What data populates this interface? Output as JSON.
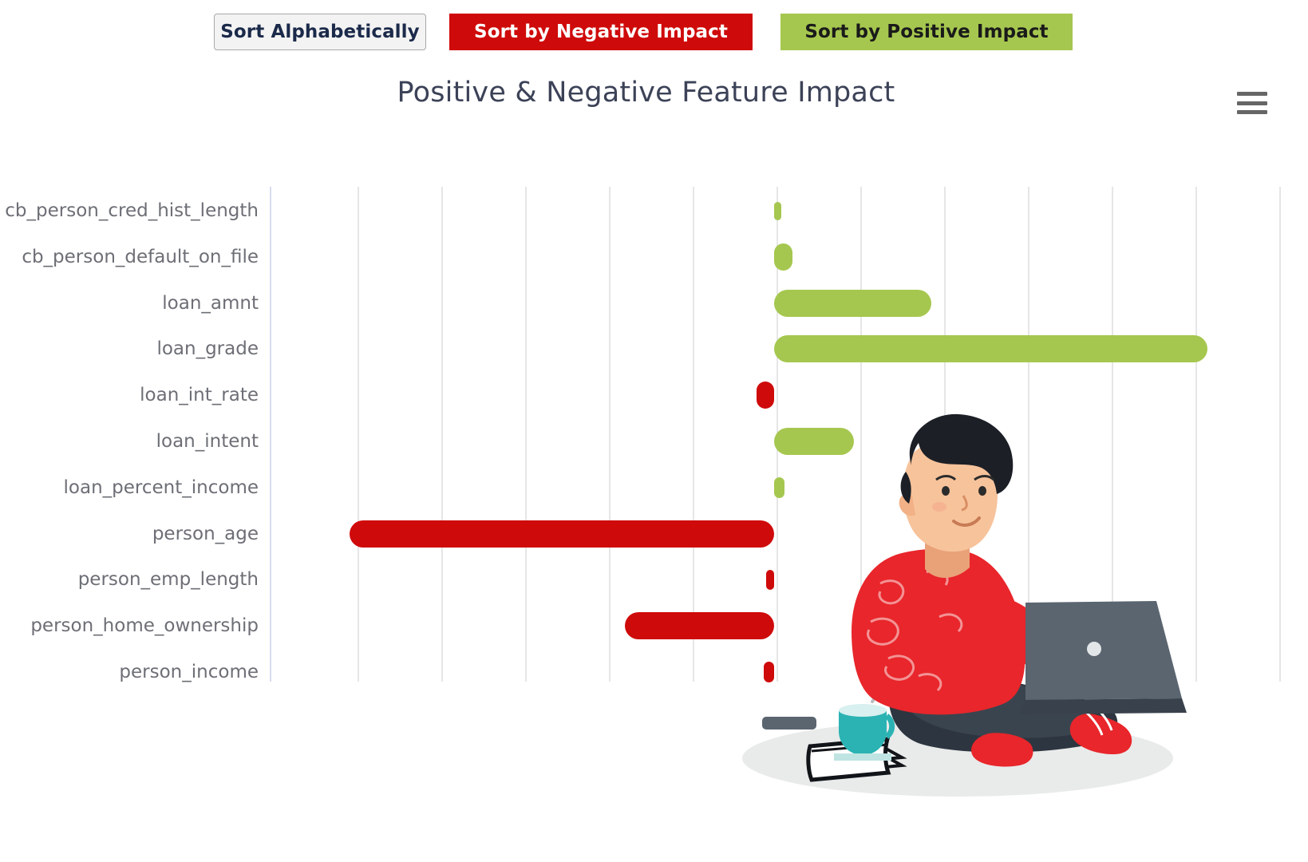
{
  "toolbar": {
    "sort_alphabetically": "Sort Alphabetically",
    "sort_by_negative": "Sort by Negative Impact",
    "sort_by_positive": "Sort by Positive Impact"
  },
  "menu": {
    "icon": "hamburger-menu-icon"
  },
  "chart_data": {
    "type": "bar",
    "orientation": "horizontal",
    "title": "Positive & Negative Feature Impact",
    "xlabel": "",
    "ylabel": "",
    "grid": true,
    "legend": false,
    "zero_line": 0,
    "xlim": [
      -5,
      7
    ],
    "categories": [
      "cb_person_cred_hist_length",
      "cb_person_default_on_file",
      "loan_amnt",
      "loan_grade",
      "loan_int_rate",
      "loan_intent",
      "loan_percent_income",
      "person_age",
      "person_emp_length",
      "person_home_ownership",
      "person_income"
    ],
    "values": [
      0.05,
      0.22,
      1.88,
      5.17,
      -0.21,
      0.95,
      0.12,
      -5.07,
      -0.1,
      -1.78,
      -0.12
    ],
    "colors": {
      "positive": "#a6c74f",
      "negative": "#cf0a0a"
    }
  },
  "illustration": {
    "name": "person-sitting-with-laptop-illustration",
    "shirt_color": "#e8262b",
    "pants_color": "#2d3640",
    "laptop_color": "#5a6570",
    "cup_color": "#2bb3b3"
  }
}
